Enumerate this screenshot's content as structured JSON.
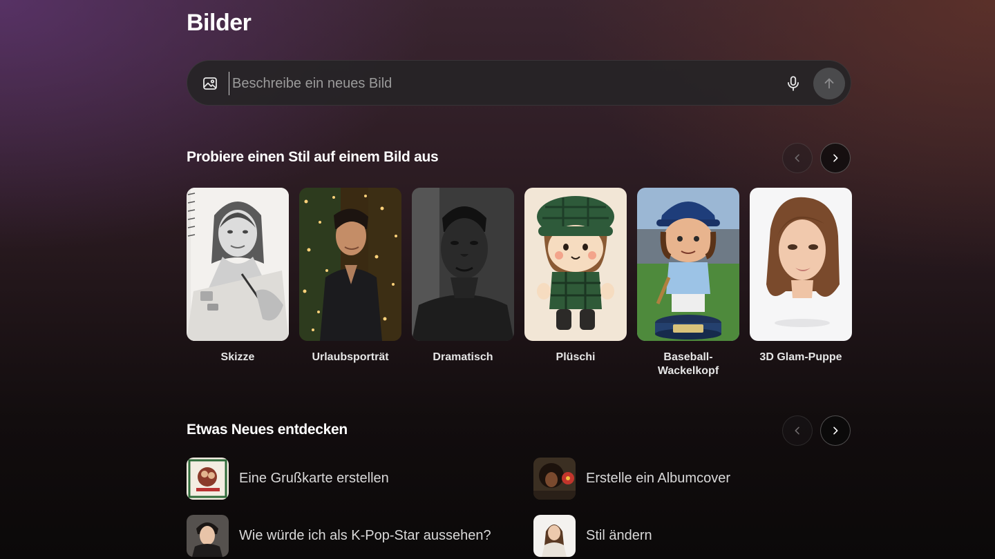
{
  "page": {
    "title": "Bilder"
  },
  "search": {
    "placeholder": "Beschreibe ein neues Bild",
    "value": "",
    "left_icon": "image-icon",
    "mic_icon": "microphone-icon",
    "send_icon": "arrow-up-icon"
  },
  "styles_section": {
    "title": "Probiere einen Stil auf einem Bild aus",
    "prev_icon": "chevron-left-icon",
    "next_icon": "chevron-right-icon",
    "cards": [
      {
        "label": "Skizze"
      },
      {
        "label": "Urlaubsporträt"
      },
      {
        "label": "Dramatisch"
      },
      {
        "label": "Plüschi"
      },
      {
        "label": "Baseball-Wackelkopf"
      },
      {
        "label": "3D Glam-Puppe"
      }
    ]
  },
  "discover_section": {
    "title": "Etwas Neues entdecken",
    "prev_icon": "chevron-left-icon",
    "next_icon": "chevron-right-icon",
    "items": [
      {
        "label": "Eine Grußkarte erstellen"
      },
      {
        "label": "Erstelle ein Albumcover"
      },
      {
        "label": "Wie würde ich als K-Pop-Star aussehen?"
      },
      {
        "label": "Stil ändern"
      }
    ]
  },
  "colors": {
    "background_top_left": "#5c346e",
    "background_top_right": "#603228",
    "background_bottom": "#0b0909",
    "search_bg": "#262426",
    "send_button_bg": "#4a4a4c",
    "text_primary": "#ffffff",
    "text_secondary": "#d9d9d9"
  }
}
